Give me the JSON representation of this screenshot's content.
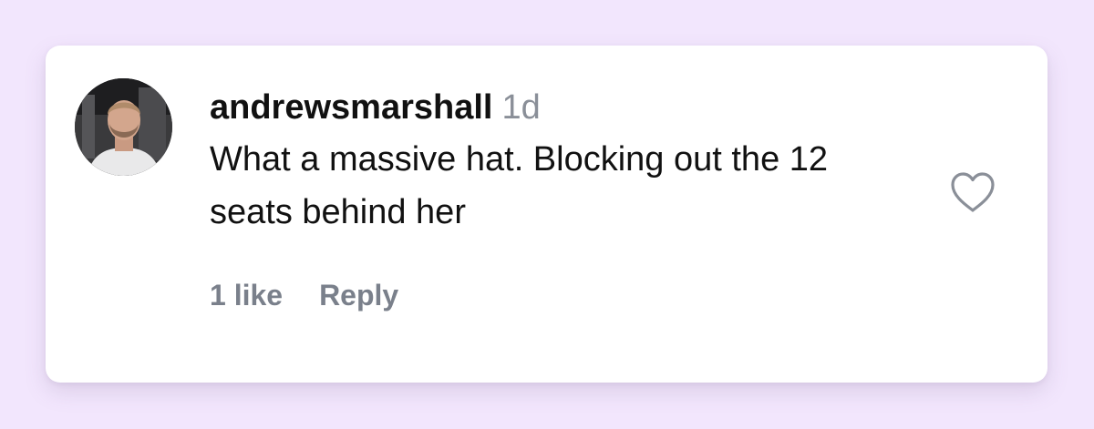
{
  "comment": {
    "username": "andrewsmarshall",
    "timestamp": "1d",
    "text": "What a massive hat. Blocking out the 12 seats behind her",
    "likes_label": "1 like",
    "reply_label": "Reply",
    "avatar_icon": "user-avatar",
    "like_icon": "heart-outline-icon"
  },
  "colors": {
    "page_background": "#f2e6fd",
    "card_background": "#ffffff",
    "text_primary": "#111111",
    "text_secondary": "#8a8f98",
    "action_text": "#7a808b"
  }
}
